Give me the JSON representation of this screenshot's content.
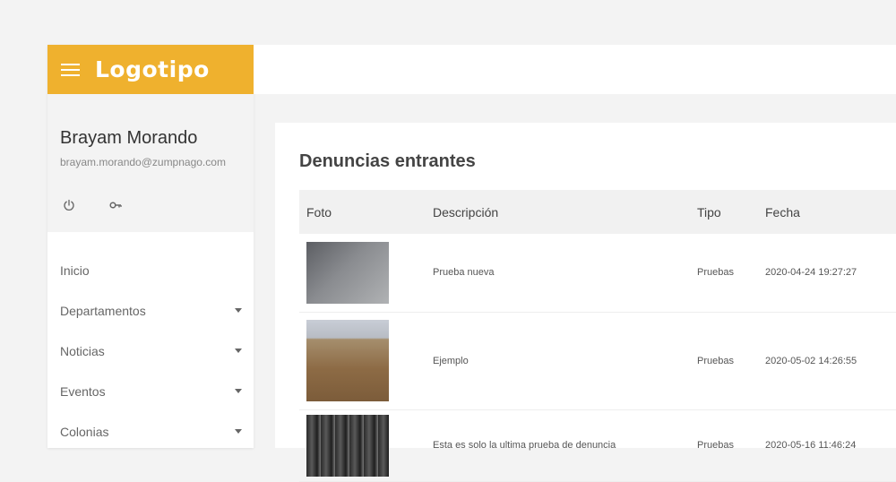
{
  "sidebar": {
    "logo": "Logotipo",
    "user": {
      "name": "Brayam Morando",
      "email": "brayam.morando@zumpnago.com",
      "actions": [
        {
          "icon": "power-icon"
        },
        {
          "icon": "key-icon"
        }
      ]
    },
    "menu": [
      {
        "label": "Inicio",
        "has_submenu": false
      },
      {
        "label": "Departamentos",
        "has_submenu": true
      },
      {
        "label": "Noticias",
        "has_submenu": true
      },
      {
        "label": "Eventos",
        "has_submenu": true
      },
      {
        "label": "Colonias",
        "has_submenu": true
      }
    ]
  },
  "colors": {
    "brand": "#efb12e",
    "background": "#f3f3f3",
    "header_row": "#f1f1f1"
  },
  "main": {
    "title": "Denuncias entrantes",
    "table": {
      "columns": [
        "Foto",
        "Descripción",
        "Tipo",
        "Fecha"
      ],
      "rows": [
        {
          "descripcion": "Prueba nueva",
          "tipo": "Pruebas",
          "fecha": "2020-04-24 19:27:27"
        },
        {
          "descripcion": "Ejemplo",
          "tipo": "Pruebas",
          "fecha": "2020-05-02 14:26:55"
        },
        {
          "descripcion": "Esta es solo la ultima prueba de denuncia",
          "tipo": "Pruebas",
          "fecha": "2020-05-16 11:46:24"
        }
      ]
    }
  }
}
